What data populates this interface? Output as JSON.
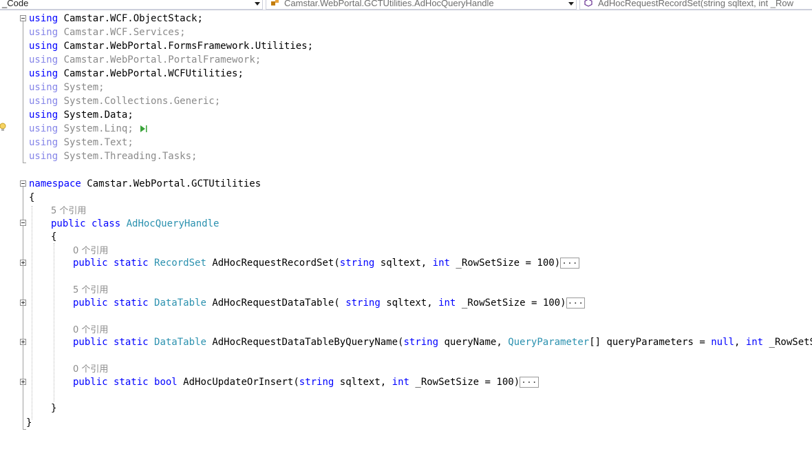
{
  "navbar": {
    "project_combo": "_Code",
    "class_combo": "Camstar.WebPortal.GCTUtilities.AdHocQueryHandle",
    "member_combo": "AdHocRequestRecordSet(string sqltext, int _Row"
  },
  "code": {
    "usings": [
      {
        "kw": "using",
        "ns": "Camstar.WCF.ObjectStack",
        "dim": false
      },
      {
        "kw": "using",
        "ns": "Camstar.WCF.Services",
        "dim": true
      },
      {
        "kw": "using",
        "ns": "Camstar.WebPortal.FormsFramework.Utilities",
        "dim": false
      },
      {
        "kw": "using",
        "ns": "Camstar.WebPortal.PortalFramework",
        "dim": true
      },
      {
        "kw": "using",
        "ns": "Camstar.WebPortal.WCFUtilities",
        "dim": false
      },
      {
        "kw": "using",
        "ns": "System",
        "dim": true
      },
      {
        "kw": "using",
        "ns": "System.Collections.Generic",
        "dim": true
      },
      {
        "kw": "using",
        "ns": "System.Data",
        "dim": false
      },
      {
        "kw": "using",
        "ns": "System.Linq",
        "dim": true
      },
      {
        "kw": "using",
        "ns": "System.Text",
        "dim": true
      },
      {
        "kw": "using",
        "ns": "System.Threading.Tasks",
        "dim": true
      }
    ],
    "semicolon": ";",
    "namespace_kw": "namespace",
    "namespace_name": "Camstar.WebPortal.GCTUtilities",
    "open_brace": "{",
    "close_brace": "}",
    "class_refs": "5 个引用",
    "class_mods": "public class",
    "class_name": "AdHocQueryHandle",
    "methods": [
      {
        "refs": "0 个引用",
        "mods": "public static",
        "ret": "RecordSet",
        "ret_is_type": true,
        "name": "AdHocRequestRecordSet",
        "params": "(string sqltext, int _RowSetSize = 100)",
        "p_kw1": "string",
        "p1": "sqltext",
        "p_kw2": "int",
        "p2": "_RowSetSize = 100",
        "prefix": "(",
        "collapsed": "..."
      },
      {
        "refs": "5 个引用",
        "mods": "public static",
        "ret": "DataTable",
        "ret_is_type": true,
        "name": "AdHocRequestDataTable",
        "prefix": "( ",
        "p_kw1": "string",
        "p1": "sqltext",
        "p_kw2": "int",
        "p2": "_RowSetSize = 100",
        "collapsed": "..."
      },
      {
        "refs": "0 个引用",
        "mods": "public static",
        "ret": "DataTable",
        "ret_is_type": true,
        "name": "AdHocRequestDataTableByQueryName",
        "prefix": "(",
        "p_kw1": "string",
        "p1": "queryName",
        "p_ty2": "QueryParameter",
        "p2b": "[] queryParameters = ",
        "p_kw3": "null",
        "p_kw4": "int",
        "p4": "_RowSetSize ="
      },
      {
        "refs": "0 个引用",
        "mods": "public static",
        "ret": "bool",
        "ret_is_type": false,
        "name": "AdHocUpdateOrInsert",
        "prefix": "(",
        "p_kw1": "string",
        "p1": "sqltext",
        "p_kw2": "int",
        "p2": "_RowSetSize = 100",
        "collapsed": "..."
      }
    ]
  },
  "colors": {
    "keyword": "#0000ff",
    "type": "#2b91af",
    "dimmed": "#8a8a8a"
  }
}
